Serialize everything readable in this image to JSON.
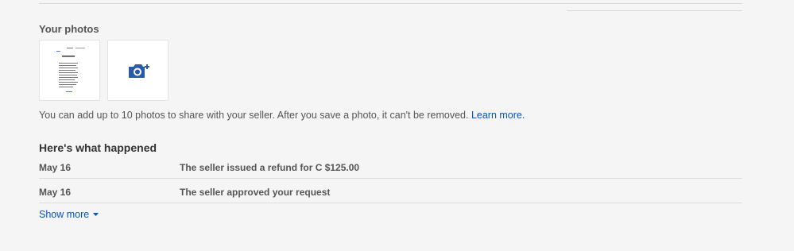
{
  "photos": {
    "heading": "Your photos",
    "info_text": "You can add up to 10 photos to share with your seller. After you save a photo, it can't be removed.",
    "learn_more": "Learn more.",
    "thumbnails": [
      {
        "kind": "document-preview",
        "icon": "document-thumbnail"
      },
      {
        "kind": "add-photo",
        "icon": "camera-plus-icon"
      }
    ]
  },
  "history": {
    "heading": "Here's what happened",
    "events": [
      {
        "date": "May 16",
        "description": "The seller issued a refund for C $125.00"
      },
      {
        "date": "May 16",
        "description": "The seller approved your request"
      }
    ],
    "show_more": "Show more"
  },
  "colors": {
    "background": "#f5f5f5",
    "link": "#0654ba",
    "camera_icon": "#2b5aa8",
    "divider": "#dddddd"
  }
}
